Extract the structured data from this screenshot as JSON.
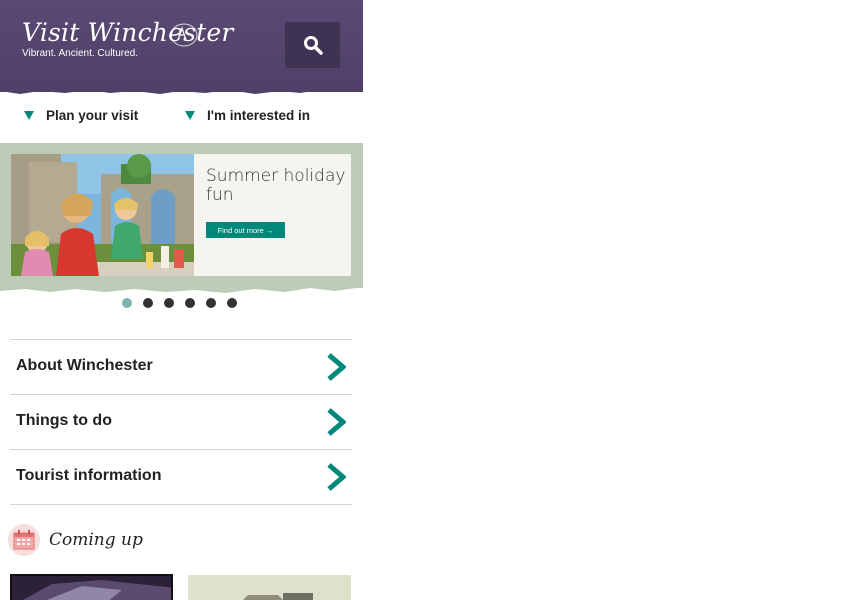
{
  "header": {
    "logo_title": "Visit Winchester",
    "logo_tagline": "Vibrant. Ancient. Cultured.",
    "search_icon": "search-icon",
    "background_color": "#5a4a73"
  },
  "menu": {
    "plan_label": "Plan your visit",
    "interested_label": "I'm interested in"
  },
  "banner": {
    "title": "Summer holiday fun",
    "button_label": "Find out more →",
    "accent_color": "#00887a"
  },
  "carousel": {
    "slide_count": 6,
    "active_index": 0
  },
  "nav_list": {
    "items": [
      {
        "label": "About Winchester"
      },
      {
        "label": "Things to do"
      },
      {
        "label": "Tourist information"
      }
    ]
  },
  "coming_up": {
    "title": "Coming up",
    "icon": "calendar-icon"
  }
}
